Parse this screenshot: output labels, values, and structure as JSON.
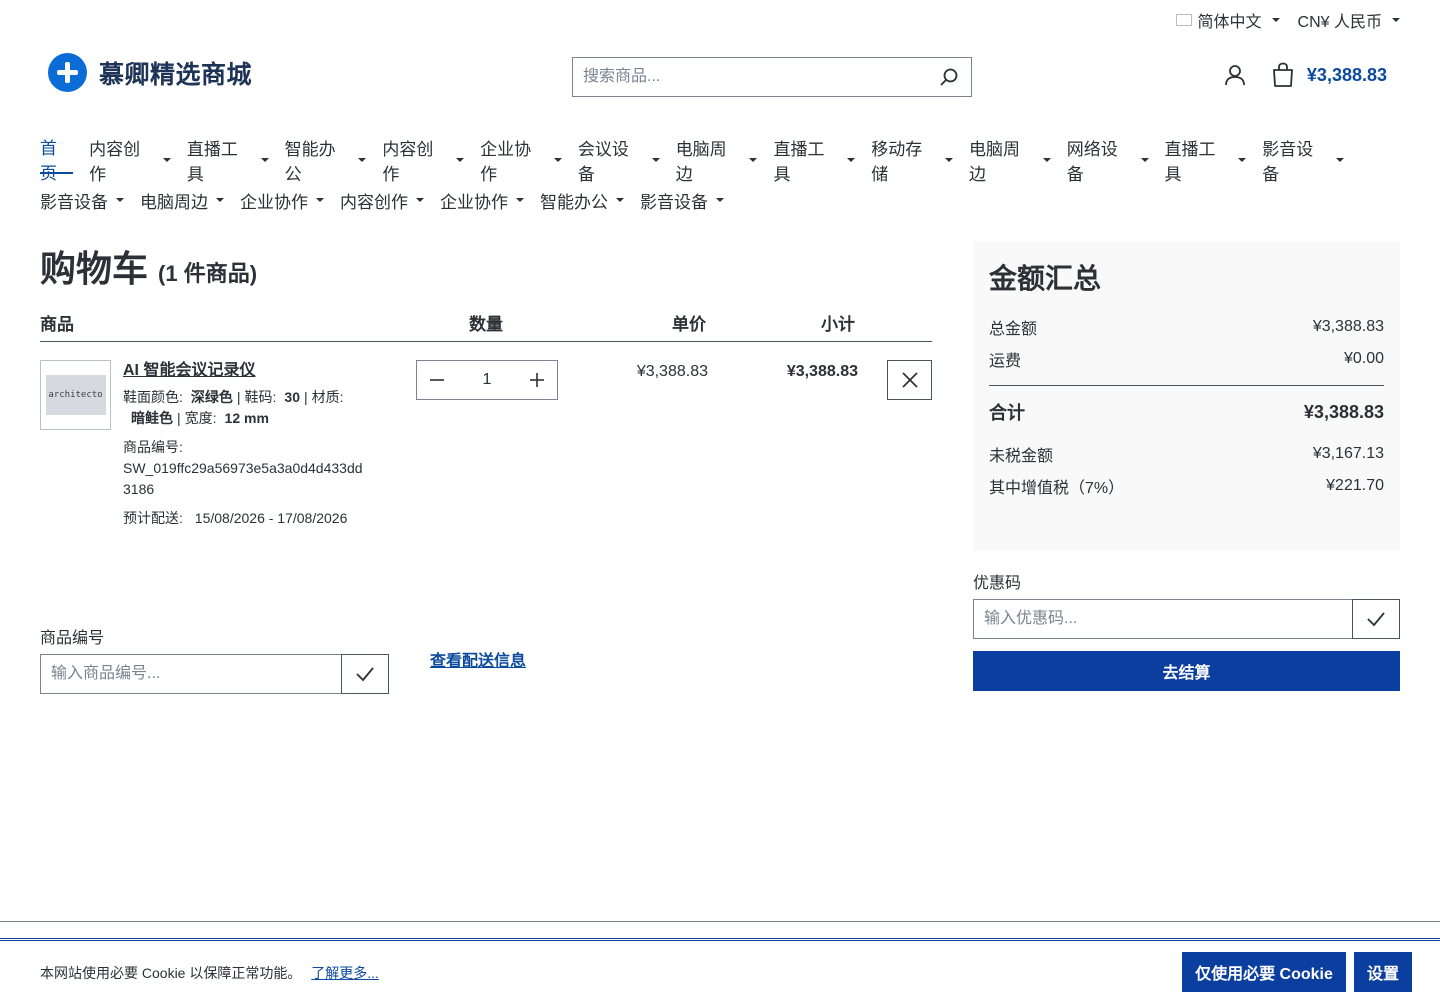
{
  "topbar": {
    "language": "简体中文",
    "currency": "CN¥ 人民币"
  },
  "brand": {
    "name": "慕卿精选商城",
    "accent": "#0b6cd6"
  },
  "search": {
    "placeholder": "搜索商品..."
  },
  "header": {
    "cart_total": "¥3,388.83"
  },
  "nav": {
    "row1": [
      "首页",
      "内容创作",
      "直播工具",
      "智能办公",
      "内容创作",
      "企业协作",
      "会议设备",
      "电脑周边",
      "直播工具",
      "移动存储",
      "电脑周边",
      "网络设备",
      "直播工具",
      "影音设备"
    ],
    "row2": [
      "影音设备",
      "电脑周边",
      "企业协作",
      "内容创作",
      "企业协作",
      "智能办公",
      "影音设备"
    ]
  },
  "cart": {
    "title": "购物车",
    "count": "(1 件商品)",
    "columns": {
      "product": "商品",
      "quantity": "数量",
      "unit_price": "单价",
      "subtotal": "小计"
    },
    "items": [
      {
        "thumb_text": "architecto",
        "name": "AI 智能会议记录仪",
        "options": [
          {
            "label": "鞋面颜色:",
            "value": "深绿色"
          },
          {
            "label": "鞋码:",
            "value": "30"
          },
          {
            "label": "材质:",
            "value": "暗鲑色"
          },
          {
            "label": "宽度:",
            "value": "12 mm"
          }
        ],
        "sku_label": "商品编号:",
        "sku": "SW_019ffc29a56973e5a3a0d4d433dd3186",
        "delivery_label": "预计配送:",
        "delivery": "15/08/2026 - 17/08/2026",
        "quantity": "1",
        "unit_price": "¥3,388.83",
        "subtotal": "¥3,388.83"
      }
    ]
  },
  "product_code": {
    "label": "商品编号",
    "placeholder": "输入商品编号..."
  },
  "shipping_link": "查看配送信息",
  "summary": {
    "title": "金额汇总",
    "subtotal_label": "总金额",
    "subtotal": "¥3,388.83",
    "shipping_label": "运费",
    "shipping": "¥0.00",
    "total_label": "合计",
    "total": "¥3,388.83",
    "net_label": "未税金额",
    "net": "¥3,167.13",
    "vat_label": "其中增值税（7%）",
    "vat": "¥221.70"
  },
  "coupon": {
    "label": "优惠码",
    "placeholder": "输入优惠码..."
  },
  "checkout_label": "去结算",
  "cookie": {
    "text": "本网站使用必要 Cookie 以保障正常功能。",
    "link": "了解更多...",
    "accept_label": "仅使用必要 Cookie",
    "settings_label": "设置"
  }
}
